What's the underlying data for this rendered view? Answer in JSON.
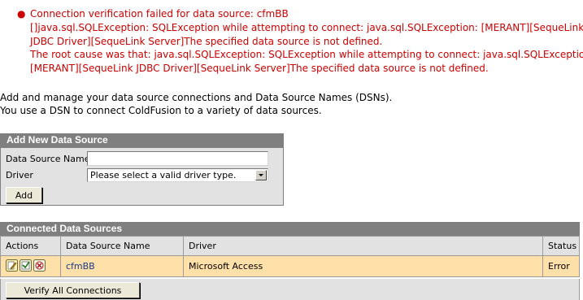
{
  "error": {
    "lines": [
      "Connection verification failed for data source: cfmBB",
      "[]java.sql.SQLException: SQLException while attempting to connect: java.sql.SQLException: [MERANT][SequeLink",
      "JDBC Driver][SequeLink Server]The specified data source is not defined.",
      "The root cause was that: java.sql.SQLException: SQLException while attempting to connect: java.sql.SQLException:",
      "[MERANT][SequeLink JDBC Driver][SequeLink Server]The specified data source is not defined."
    ]
  },
  "intro": {
    "line1": "Add and manage your data source connections and Data Source Names (DSNs).",
    "line2": "You use a DSN to connect ColdFusion to a variety of data sources."
  },
  "add_panel": {
    "title": "Add New Data Source",
    "name_label": "Data Source Name",
    "name_value": "",
    "driver_label": "Driver",
    "driver_selected": "Please select a valid driver type.",
    "add_button": "Add"
  },
  "connected": {
    "title": "Connected Data Sources",
    "columns": [
      "Actions",
      "Data Source Name",
      "Driver",
      "Status"
    ],
    "rows": [
      {
        "name": "cfmBB",
        "driver": "Microsoft Access",
        "status": "Error"
      }
    ],
    "verify_button": "Verify All Connections"
  },
  "icons": {
    "edit": "edit-icon",
    "verify": "verify-icon",
    "delete": "delete-icon",
    "bullet": "bullet-icon"
  },
  "colors": {
    "error_text": "#cc0000",
    "header_bg": "#7f7f7f",
    "panel_bg": "#e2e2e2",
    "row_highlight": "#ffe0a8"
  }
}
